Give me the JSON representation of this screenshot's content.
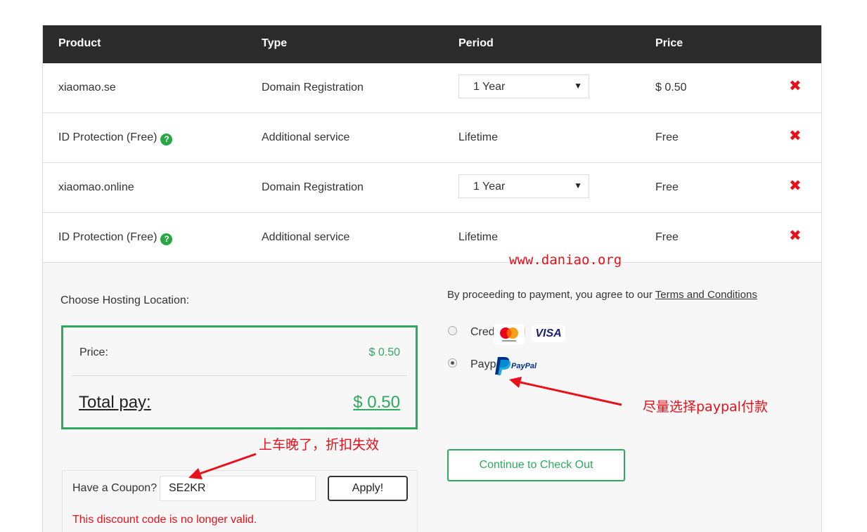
{
  "table": {
    "headers": [
      "Product",
      "Type",
      "Period",
      "Price"
    ],
    "rows": [
      {
        "product": "xiaomao.se",
        "type": "Domain Registration",
        "period": "1 Year",
        "period_select": true,
        "price": "$ 0.50",
        "help": false
      },
      {
        "product": "ID Protection (Free)",
        "type": "Additional service",
        "period": "Lifetime",
        "period_select": false,
        "price": "Free",
        "help": true
      },
      {
        "product": "xiaomao.online",
        "type": "Domain Registration",
        "period": "1 Year",
        "period_select": true,
        "price": "Free",
        "help": false
      },
      {
        "product": "ID Protection (Free)",
        "type": "Additional service",
        "period": "Lifetime",
        "period_select": false,
        "price": "Free",
        "help": true
      }
    ],
    "remove_glyph": "✖",
    "help_glyph": "?"
  },
  "hosting": {
    "label": "Choose Hosting Location:"
  },
  "totals": {
    "price_label": "Price:",
    "price_value": "$ 0.50",
    "total_label": "Total pay:",
    "total_value": "$ 0.50"
  },
  "coupon": {
    "label": "Have a Coupon?",
    "value": "SE2KR",
    "apply_label": "Apply!",
    "error": "This discount code is no longer valid."
  },
  "payment": {
    "terms_prefix": "By proceeding to payment, you agree to our ",
    "terms_link": "Terms and Conditions",
    "methods": [
      {
        "label": "Credit card",
        "selected": false,
        "icons": [
          "mastercard-icon",
          "visa-icon"
        ],
        "visa_text": "VISA"
      },
      {
        "label": "Paypal",
        "selected": true,
        "icons": [
          "paypal-icon"
        ],
        "paypal_text": "PayPal"
      }
    ],
    "checkout_label": "Continue to Check Out"
  },
  "annotations": {
    "watermark": "www.daniao.org",
    "paypal_note": "尽量选择paypal付款",
    "coupon_note": "上车晚了，折扣失效",
    "color": "#e8111a"
  },
  "colors": {
    "header_bg": "#2b2b2b",
    "accent_green": "#2eaa5e",
    "error_red": "#e8111a"
  }
}
